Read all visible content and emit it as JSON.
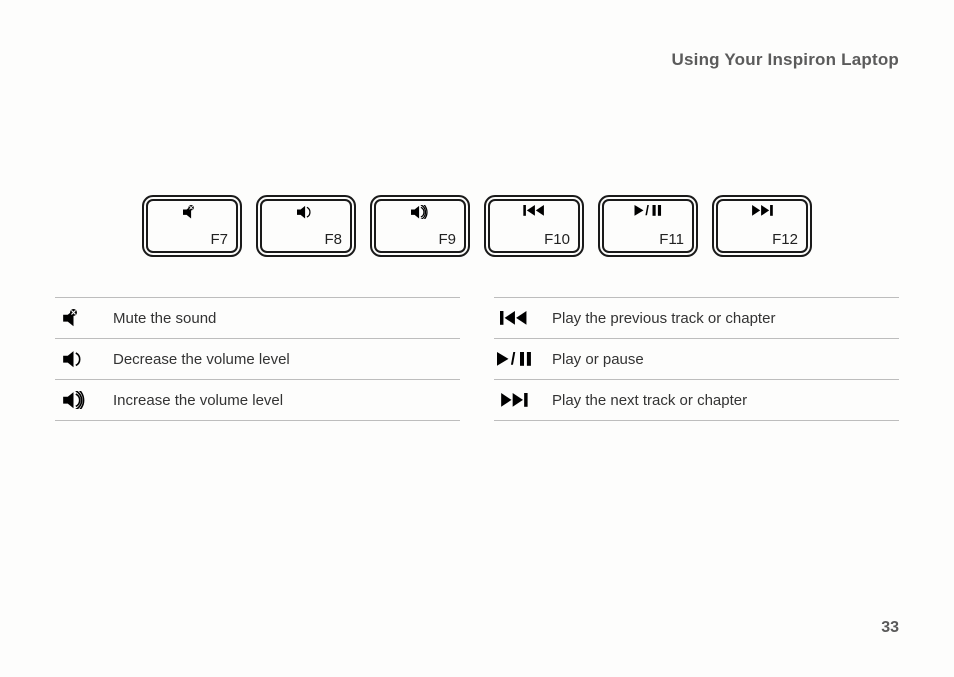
{
  "header": {
    "title": "Using Your Inspiron Laptop"
  },
  "keys": [
    {
      "icon": "mute-icon",
      "label": "F7"
    },
    {
      "icon": "volume-down-icon",
      "label": "F8"
    },
    {
      "icon": "volume-up-icon",
      "label": "F9"
    },
    {
      "icon": "previous-track-icon",
      "label": "F10"
    },
    {
      "icon": "play-pause-icon",
      "label": "F11"
    },
    {
      "icon": "next-track-icon",
      "label": "F12"
    }
  ],
  "legend_left": [
    {
      "icon": "mute-icon",
      "text": "Mute the sound"
    },
    {
      "icon": "volume-down-icon",
      "text": "Decrease the volume level"
    },
    {
      "icon": "volume-up-icon",
      "text": "Increase the volume level"
    }
  ],
  "legend_right": [
    {
      "icon": "previous-track-icon",
      "text": "Play the previous track or chapter"
    },
    {
      "icon": "play-pause-icon",
      "text": "Play or pause"
    },
    {
      "icon": "next-track-icon",
      "text": "Play the next track or chapter"
    }
  ],
  "page_number": "33"
}
